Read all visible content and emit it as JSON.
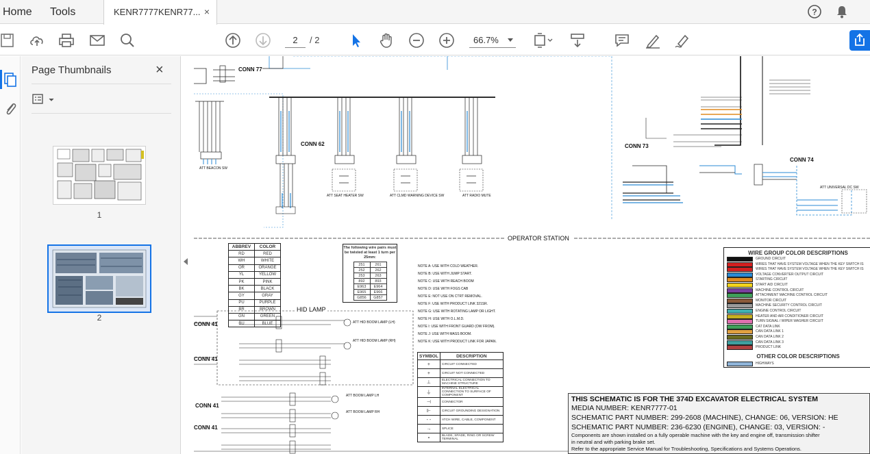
{
  "menubar": {
    "home_label": "Home",
    "tools_label": "Tools",
    "doc_tab_label": "KENR7777KENR77...",
    "doc_tab_close": "×"
  },
  "toolbar": {
    "current_page": "2",
    "total_pages": "/ 2",
    "zoom": "66.7%"
  },
  "thumbnails_panel": {
    "title": "Page Thumbnails",
    "close": "×",
    "thumbnails": [
      {
        "label": "1",
        "selected": false
      },
      {
        "label": "2",
        "selected": true
      }
    ]
  },
  "document": {
    "section_operator_station": "OPERATOR STATION",
    "hid_lamp": "HID LAMP",
    "connectors": [
      "CONN 77",
      "CONN 62",
      "CONN 73",
      "CONN 74",
      "CONN 41",
      "CONN 41",
      "CONN 41",
      "CONN 41"
    ],
    "component_labels": [
      "ATT BEACON SW",
      "ATT SEAT HEATER SW",
      "ATT CLMD WARNING DEVICE SW",
      "ATT RADIO MUTE",
      "ATT UNIVERSAL DC SW",
      "ATT HID BOOM LAMP (LH)",
      "ATT HID BOOM LAMP (RH)",
      "ATT BOOM LAMP LH",
      "ATT BOOM LAMP RH"
    ],
    "abbrev_table": {
      "headers": [
        "ABBREV",
        "COLOR"
      ],
      "rows": [
        [
          "RD",
          "RED"
        ],
        [
          "WH",
          "WHITE"
        ],
        [
          "OR",
          "ORANGE"
        ],
        [
          "YL",
          "YELLOW"
        ],
        [
          "PK",
          "PINK"
        ],
        [
          "BK",
          "BLACK"
        ],
        [
          "GY",
          "GRAY"
        ],
        [
          "PU",
          "PURPLE"
        ],
        [
          "BR",
          "BROWN"
        ],
        [
          "GN",
          "GREEN"
        ],
        [
          "BU",
          "BLUE"
        ]
      ]
    },
    "twisted_pairs": {
      "header": "The following wire pairs must be twisted at least 1 turn per 25mm:",
      "rows": [
        [
          "251",
          "261"
        ],
        [
          "252",
          "262"
        ],
        [
          "253",
          "263"
        ],
        [
          "892",
          "893"
        ],
        [
          "E963",
          "E964"
        ],
        [
          "E965",
          "E966"
        ],
        [
          "G856",
          "G857"
        ]
      ]
    },
    "notes": [
      "NOTE A: USE WITH COLD WEATHER.",
      "NOTE B: USE WITH JUMP START.",
      "NOTE C: USE WITH REACH BOOM",
      "NOTE D: USE WITH FOGS CAB",
      "NOTE E: NOT USE ON CTRT REMOVAL.",
      "NOTE F: USE WITH PRODUCT LINK 321SR.",
      "NOTE G: USE WITH ROTATING LAMP OR LIGHT.",
      "NOTE H: USE WITH O.L.M.D.",
      "NOTE I: USE WITH FRONT GUARD (OW FROM).",
      "NOTE J: USE WITH MASS BOOM.",
      "NOTE K: USE WITH PRODUCT LINK FOR JAPAN.",
      "NOTE L: USE WITH 12V RADIO READY."
    ],
    "symbol_table": {
      "headers": [
        "SYMBOL",
        "DESCRIPTION"
      ],
      "rows": [
        {
          "symbol": "+",
          "desc": "CIRCUIT CONNECTED"
        },
        {
          "symbol": "+",
          "desc": "CIRCUIT NOT CONNECTED"
        },
        {
          "symbol": "⊥",
          "desc": "ELECTRICAL CONNECTION TO MACHINE STRUCTURE"
        },
        {
          "symbol": "⏚",
          "desc": "INTERNAL ELECTRICAL CONNECTION TO SURFACE OF COMPONENT"
        },
        {
          "symbol": "⊣",
          "desc": "CONNECTOR"
        },
        {
          "symbol": "⊩",
          "desc": "CIRCUIT GROUNDING DESIGNATION"
        },
        {
          "symbol": "- -",
          "desc": "ATCH WIRE, CABLE, COMPONENT"
        },
        {
          "symbol": "→",
          "desc": "SPLICE"
        },
        {
          "symbol": "∘",
          "desc": "BLADE, SPADE, RING OR SCREW TERMINAL"
        }
      ]
    },
    "wire_group_colors": {
      "title": "WIRE GROUP COLOR DESCRIPTIONS",
      "items": [
        {
          "label": "GROUND CIRCUIT",
          "color": "#111111"
        },
        {
          "label": "WIRES THAT HAVE SYSTEM VOLTAGE WHEN THE KEY SWITCH IS",
          "color": "#d42020"
        },
        {
          "label": "WIRES THAT HAVE SYSTEM VOLTAGE WHEN THE KEY SWITCH IS",
          "color": "#d42020"
        },
        {
          "label": "VOLTAGE CONVERTER OUTPUT CIRCUIT",
          "color": "#2a8ad4"
        },
        {
          "label": "STARTING CIRCUIT",
          "color": "#e08a1e"
        },
        {
          "label": "START AID CIRCUIT",
          "color": "#f2d21c"
        },
        {
          "label": "MACHINE CONTROL CIRCUIT",
          "color": "#7b3fa0"
        },
        {
          "label": "ATTACHMENT MACHINE CONTROL CIRCUIT",
          "color": "#3fa05a"
        },
        {
          "label": "MONITOR CIRCUIT",
          "color": "#8a5a3a"
        },
        {
          "label": "MACHINE SECURITY CONTROL CIRCUIT",
          "color": "#999999"
        },
        {
          "label": "ENGINE CONTROL CIRCUIT",
          "color": "#40b0b0"
        },
        {
          "label": "HEATER AND AIR CONDITIONER CIRCUIT",
          "color": "#c8b020"
        },
        {
          "label": "TURN SIGNAL / WIPER WASHER CIRCUIT",
          "color": "#e070b0"
        },
        {
          "label": "CAT DATA LINK",
          "color": "#3fa05a"
        },
        {
          "label": "CAN DATA LINK 1",
          "color": "#e0a040"
        },
        {
          "label": "CAN DATA LINK 2",
          "color": "#6a6a20"
        },
        {
          "label": "CAN DATA LINK 3",
          "color": "#40a0a0"
        },
        {
          "label": "PRODUCT LINK",
          "color": "#b04040"
        }
      ],
      "other_title": "OTHER COLOR DESCRIPTIONS",
      "other_items": [
        {
          "label": "HIGHWAYS",
          "color": "#8fb4d8"
        }
      ]
    },
    "info_box": {
      "line1": "THIS SCHEMATIC IS FOR THE 374D EXCAVATOR  ELECTRICAL SYSTEM",
      "line2": "MEDIA NUMBER:  KENR7777-01",
      "line3": "SCHEMATIC PART NUMBER: 299-2608 (MACHINE), CHANGE: 06, VERSION: HE",
      "line4": "SCHEMATIC PART NUMBER: 236-6230 (ENGINE), CHANGE: 03, VERSION: -",
      "line5": "Components are shown installed on a fully operable machine with the key and engine off, transmission shifter",
      "line6": "in neutral and with parking brake set.",
      "line7": "Refer to the appropriate Service Manual for Troubleshooting, Specifications and Systems Operations."
    }
  },
  "colors": {
    "accent": "#1473e6",
    "menubar_bg": "#f5f5f5",
    "panel_bg": "#f5f5f5",
    "schematic_blue": "#2a8ad4"
  },
  "icons": [
    "help-icon",
    "bell-icon",
    "save-icon",
    "upload-icon",
    "print-icon",
    "email-icon",
    "search-icon",
    "prev-page-icon",
    "next-page-icon",
    "select-tool-icon",
    "hand-tool-icon",
    "zoom-out-icon",
    "zoom-in-icon",
    "fit-page-icon",
    "scroll-mode-icon",
    "comment-icon",
    "highlight-icon",
    "sign-icon",
    "share-icon",
    "thumbnails-icon",
    "attachments-icon",
    "options-icon"
  ]
}
